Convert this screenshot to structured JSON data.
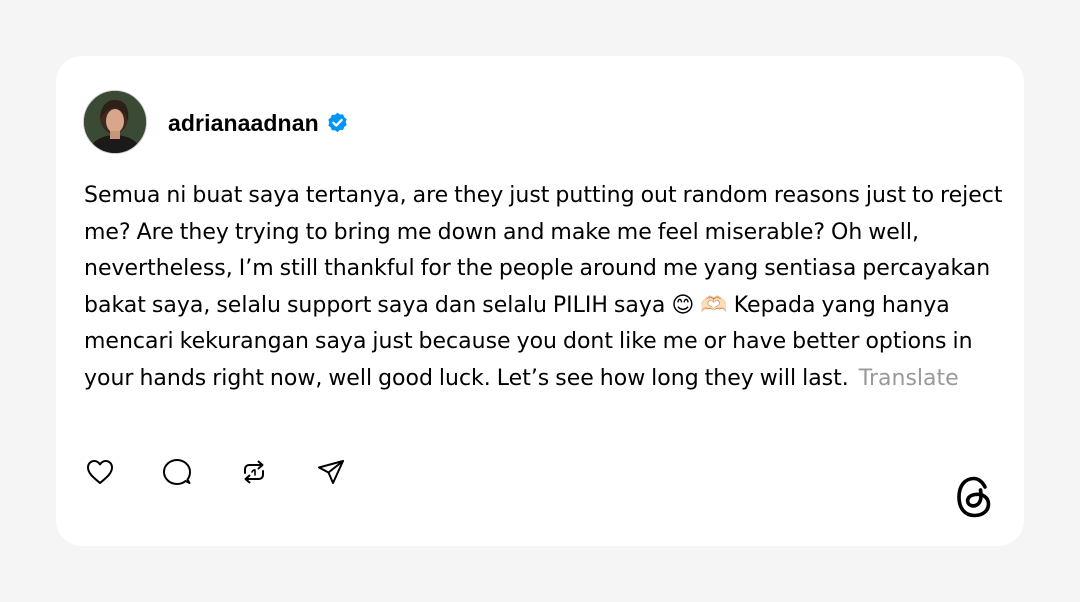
{
  "post": {
    "username": "adrianaadnan",
    "verified": true,
    "text_before_emoji": "Semua ni buat saya tertanya, are they just putting out random reasons just to reject me? Are they trying to bring me down and make me feel miserable? Oh well, nevertheless, I’m still thankful for the people around me yang sentiasa percayakan bakat saya, selalu support saya dan selalu PILIH saya ",
    "emoji_1": "😊",
    "emoji_2": "🫶🏻",
    "text_after_emoji": " Kepada yang hanya mencari kekurangan saya just because you dont like me or have better options in your hands right now, well good luck. Let’s see how long they will last.",
    "translate_label": "Translate"
  },
  "actions": {
    "like_icon": "heart-icon",
    "reply_icon": "comment-icon",
    "repost_icon": "repost-icon",
    "share_icon": "send-icon"
  },
  "branding": {
    "logo": "threads-logo-icon"
  },
  "colors": {
    "background": "#f5f5f5",
    "card": "#ffffff",
    "text": "#000000",
    "muted": "#999999",
    "verified": "#0095f6"
  }
}
